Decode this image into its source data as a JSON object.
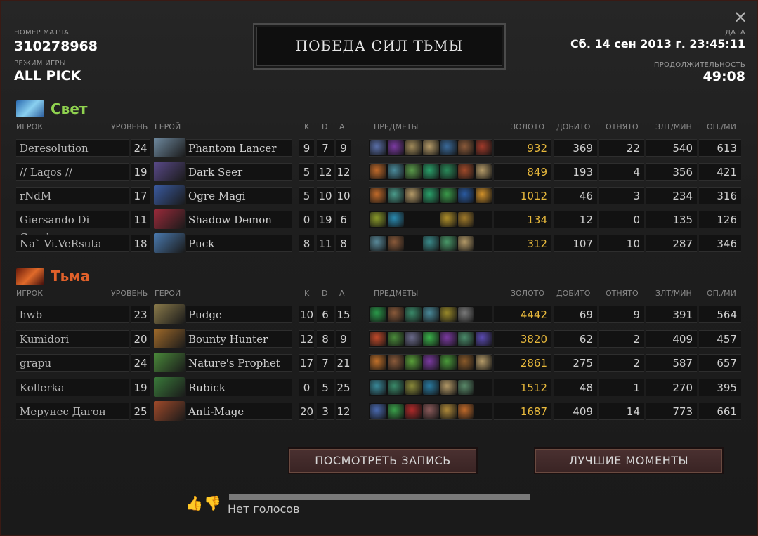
{
  "header": {
    "match_label": "НОМЕР МАТЧА",
    "match_id": "310278968",
    "mode_label": "РЕЖИМ ИГРЫ",
    "mode": "ALL PICK",
    "result": "ПОБЕДА СИЛ ТЬМЫ",
    "date_label": "ДАТА",
    "date": "Сб. 14 сен 2013 г. 23:45:11",
    "duration_label": "ПРОДОЛЖИТЕЛЬНОСТЬ",
    "duration": "49:08"
  },
  "columns": {
    "player": "ИГРОК",
    "level": "УРОВЕНЬ",
    "hero": "ГЕРОЙ",
    "k": "K",
    "d": "D",
    "a": "A",
    "items": "ПРЕДМЕТЫ",
    "gold": "ЗОЛОТО",
    "last_hits": "ДОБИТО",
    "denies": "ОТНЯТО",
    "gpm": "ЗЛТ/МИН",
    "xpm": "ОП./МИ"
  },
  "radiant": {
    "name": "Свет",
    "color": "#8fd14f",
    "players": [
      {
        "player": "Deresolution",
        "level": "24",
        "hero": "Phantom Lancer",
        "k": "9",
        "d": "7",
        "a": "9",
        "gold": "932",
        "lh": "369",
        "dn": "22",
        "gpm": "540",
        "xpm": "613",
        "portrait": "#6f8aa0",
        "items": [
          "#5a6fa8",
          "#7a3aa0",
          "#a08a5a",
          "#b49a68",
          "#3a6a9a",
          "#8a5a3a",
          "#a03a2a"
        ]
      },
      {
        "player": "// Laqos //",
        "level": "19",
        "hero": "Dark Seer",
        "k": "5",
        "d": "12",
        "a": "12",
        "gold": "849",
        "lh": "193",
        "dn": "4",
        "gpm": "356",
        "xpm": "421",
        "portrait": "#5a4a8a",
        "items": [
          "#c06a2a",
          "#4a8a9a",
          "#5a9a4a",
          "#2aa06a",
          "#2a8a5a",
          "#a04a2a",
          "#b49a68"
        ]
      },
      {
        "player": "rNdM",
        "level": "17",
        "hero": "Ogre Magi",
        "k": "5",
        "d": "10",
        "a": "10",
        "gold": "1012",
        "lh": "46",
        "dn": "3",
        "gpm": "234",
        "xpm": "316",
        "portrait": "#3a5aa0",
        "items": [
          "#c06a2a",
          "#4a9a8a",
          "#b49a68",
          "#2aa06a",
          "#3a9a4a",
          "#2a5aa0",
          "#d0902a"
        ]
      },
      {
        "player": "Giersando Di Caprio",
        "level": "11",
        "hero": "Shadow Demon",
        "k": "0",
        "d": "19",
        "a": "6",
        "gold": "134",
        "lh": "12",
        "dn": "0",
        "gpm": "135",
        "xpm": "126",
        "portrait": "#9a2a3a",
        "items": [
          "#8a9a2a",
          "#2a8ab0",
          "",
          "",
          "#b0902a",
          "#a07a2a",
          ""
        ]
      },
      {
        "player": "Na` Vi.VeRsuta",
        "level": "18",
        "hero": "Puck",
        "k": "8",
        "d": "11",
        "a": "8",
        "gold": "312",
        "lh": "107",
        "dn": "10",
        "gpm": "287",
        "xpm": "346",
        "portrait": "#4a7ab0",
        "items": [
          "#5a8a9a",
          "#8a5a3a",
          "",
          "#3a8a8a",
          "#4a9a6a",
          "#b49a68",
          ""
        ]
      }
    ]
  },
  "dire": {
    "name": "Тьма",
    "color": "#e0602a",
    "players": [
      {
        "player": "hwb",
        "level": "23",
        "hero": "Pudge",
        "k": "10",
        "d": "6",
        "a": "15",
        "gold": "4442",
        "lh": "69",
        "dn": "9",
        "gpm": "391",
        "xpm": "564",
        "portrait": "#8a7a4a",
        "items": [
          "#2a9a4a",
          "#8a5a3a",
          "#3a8a6a",
          "#4a8a9a",
          "#9a8a2a",
          "#7a7a7a",
          ""
        ]
      },
      {
        "player": "Kumidori",
        "level": "20",
        "hero": "Bounty Hunter",
        "k": "12",
        "d": "8",
        "a": "9",
        "gold": "3820",
        "lh": "62",
        "dn": "2",
        "gpm": "409",
        "xpm": "457",
        "portrait": "#a06a2a",
        "items": [
          "#c04a2a",
          "#4a8a3a",
          "#6a6a8a",
          "#3ab04a",
          "#7a3aa0",
          "#4a8a6a",
          "#5a4ab0"
        ]
      },
      {
        "player": "grapu",
        "level": "24",
        "hero": "Nature's Prophet",
        "k": "17",
        "d": "7",
        "a": "21",
        "gold": "2861",
        "lh": "275",
        "dn": "2",
        "gpm": "587",
        "xpm": "657",
        "portrait": "#4a8a3a",
        "items": [
          "#c0702a",
          "#8a5a3a",
          "#5aa03a",
          "#7a3aa0",
          "#4a9a3a",
          "#8a5a2a",
          "#b49a68"
        ]
      },
      {
        "player": "Kollerka",
        "level": "19",
        "hero": "Rubick",
        "k": "0",
        "d": "5",
        "a": "25",
        "gold": "1512",
        "lh": "48",
        "dn": "1",
        "gpm": "270",
        "xpm": "395",
        "portrait": "#3a7a3a",
        "items": [
          "#3a8a9a",
          "#3a8a6a",
          "#8a8a3a",
          "#2a7aa0",
          "#b49a68",
          "#5a8a6a",
          ""
        ]
      },
      {
        "player": "Мерунес Дагон",
        "level": "25",
        "hero": "Anti-Mage",
        "k": "20",
        "d": "3",
        "a": "12",
        "gold": "1687",
        "lh": "409",
        "dn": "14",
        "gpm": "773",
        "xpm": "661",
        "portrait": "#a04a2a",
        "items": [
          "#4a6ab0",
          "#3aa04a",
          "#b02a2a",
          "#8a5a5a",
          "#b08a3a",
          "#c06a2a",
          ""
        ]
      }
    ]
  },
  "buttons": {
    "watch": "ПОСМОТРЕТЬ ЗАПИСЬ",
    "highlights": "ЛУЧШИЕ МОМЕНТЫ"
  },
  "votes": {
    "text": "Нет голосов"
  }
}
